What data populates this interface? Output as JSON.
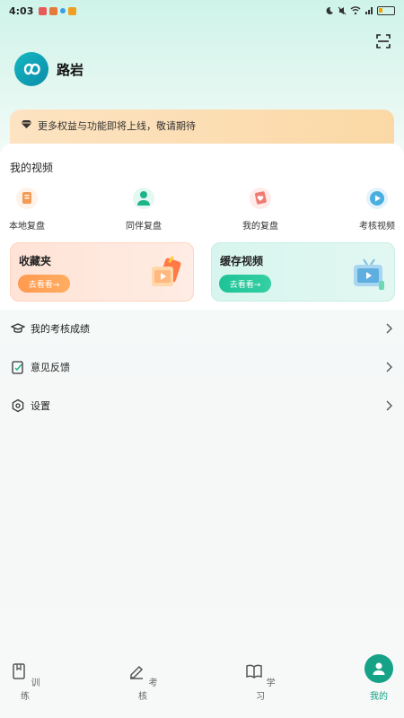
{
  "status_bar": {
    "time": "4:03"
  },
  "profile": {
    "name": "路岩"
  },
  "notice": {
    "text": "更多权益与功能即将上线，敬请期待"
  },
  "my_videos": {
    "title": "我的视频",
    "quick_items": [
      {
        "label": "本地复盘",
        "icon": "document-icon"
      },
      {
        "label": "同伴复盘",
        "icon": "person-icon"
      },
      {
        "label": "我的复盘",
        "icon": "heart-icon"
      },
      {
        "label": "考核视频",
        "icon": "play-icon"
      }
    ],
    "tiles": [
      {
        "title": "收藏夹",
        "button": "去看看→"
      },
      {
        "title": "缓存视频",
        "button": "去看看→"
      }
    ]
  },
  "menu": [
    {
      "label": "我的考核成绩",
      "icon": "graduation-cap-icon"
    },
    {
      "label": "意见反馈",
      "icon": "feedback-icon"
    },
    {
      "label": "设置",
      "icon": "gear-icon"
    }
  ],
  "tabbar": {
    "tabs": [
      {
        "label": "训练",
        "icon": "book-icon"
      },
      {
        "label": "考核",
        "icon": "pencil-icon"
      },
      {
        "label": "学习",
        "icon": "open-book-icon"
      },
      {
        "label": "我的",
        "icon": "person-icon",
        "active": true
      }
    ]
  },
  "colors": {
    "accent": "#16a287",
    "fav_button": "#ff9a4f",
    "cache_button": "#1dc396",
    "notice_bg": "#fbd9a6"
  }
}
